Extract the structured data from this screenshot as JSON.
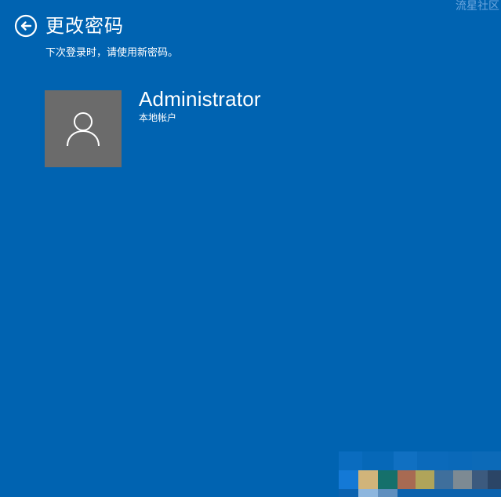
{
  "header": {
    "title": "更改密码",
    "back_icon": "back-arrow-circle-icon"
  },
  "subtitle": "下次登录时，请使用新密码。",
  "account": {
    "name": "Administrator",
    "type": "本地帐户",
    "avatar_icon": "user-silhouette-icon"
  },
  "watermark": "流星社区",
  "colors": {
    "background": "#0063b1",
    "avatar_bg": "#6b6b6b",
    "text": "#ffffff"
  }
}
